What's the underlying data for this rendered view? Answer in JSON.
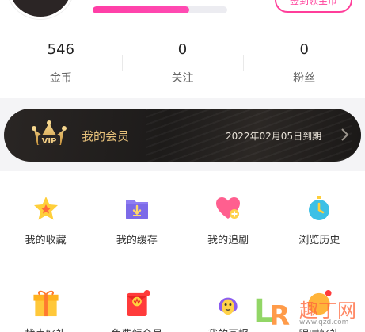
{
  "header": {
    "signin_label": "签到领金币",
    "level_progress": 0.72
  },
  "stats": [
    {
      "value": "546",
      "label": "金币"
    },
    {
      "value": "0",
      "label": "关注"
    },
    {
      "value": "0",
      "label": "粉丝"
    }
  ],
  "vip": {
    "badge_text": "VIP",
    "title": "我的会员",
    "expire": "2022年02月05日到期"
  },
  "menu_row1": [
    {
      "label": "我的收藏",
      "icon": "star-collect-icon"
    },
    {
      "label": "我的缓存",
      "icon": "download-folder-icon"
    },
    {
      "label": "我的追剧",
      "icon": "heart-plus-icon"
    },
    {
      "label": "浏览历史",
      "icon": "stopwatch-icon"
    }
  ],
  "menu_row2": [
    {
      "label": "找表好礼",
      "icon": "gift-box-icon"
    },
    {
      "label": "免费领会员",
      "icon": "red-envelope-icon"
    },
    {
      "label": "我的画报",
      "icon": "character-icon"
    },
    {
      "label": "限时好礼",
      "icon": "badge-gift-icon"
    }
  ],
  "watermark": {
    "brand": "趣丁网",
    "url": "www.qzd.com"
  },
  "colors": {
    "accent_pink": "#ff3e9a",
    "vip_gold": "#e6c07a",
    "vip_bg": "#1d1b1a"
  }
}
